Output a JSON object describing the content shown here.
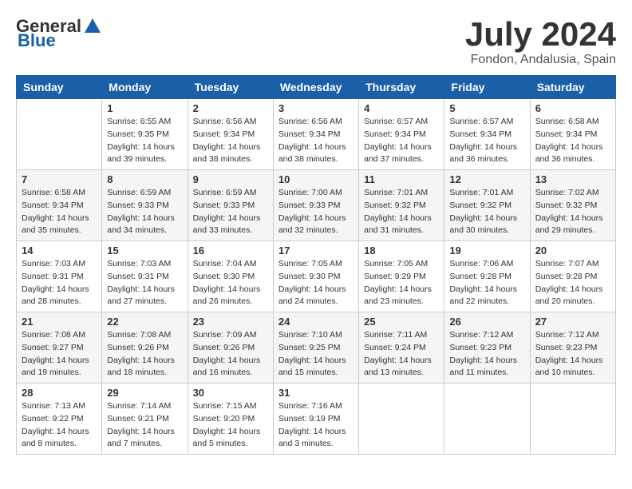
{
  "header": {
    "logo_general": "General",
    "logo_blue": "Blue",
    "month_year": "July 2024",
    "location": "Fondon, Andalusia, Spain"
  },
  "days_of_week": [
    "Sunday",
    "Monday",
    "Tuesday",
    "Wednesday",
    "Thursday",
    "Friday",
    "Saturday"
  ],
  "weeks": [
    [
      {
        "day": "",
        "sunrise": "",
        "sunset": "",
        "daylight": ""
      },
      {
        "day": "1",
        "sunrise": "Sunrise: 6:55 AM",
        "sunset": "Sunset: 9:35 PM",
        "daylight": "Daylight: 14 hours and 39 minutes."
      },
      {
        "day": "2",
        "sunrise": "Sunrise: 6:56 AM",
        "sunset": "Sunset: 9:34 PM",
        "daylight": "Daylight: 14 hours and 38 minutes."
      },
      {
        "day": "3",
        "sunrise": "Sunrise: 6:56 AM",
        "sunset": "Sunset: 9:34 PM",
        "daylight": "Daylight: 14 hours and 38 minutes."
      },
      {
        "day": "4",
        "sunrise": "Sunrise: 6:57 AM",
        "sunset": "Sunset: 9:34 PM",
        "daylight": "Daylight: 14 hours and 37 minutes."
      },
      {
        "day": "5",
        "sunrise": "Sunrise: 6:57 AM",
        "sunset": "Sunset: 9:34 PM",
        "daylight": "Daylight: 14 hours and 36 minutes."
      },
      {
        "day": "6",
        "sunrise": "Sunrise: 6:58 AM",
        "sunset": "Sunset: 9:34 PM",
        "daylight": "Daylight: 14 hours and 36 minutes."
      }
    ],
    [
      {
        "day": "7",
        "sunrise": "Sunrise: 6:58 AM",
        "sunset": "Sunset: 9:34 PM",
        "daylight": "Daylight: 14 hours and 35 minutes."
      },
      {
        "day": "8",
        "sunrise": "Sunrise: 6:59 AM",
        "sunset": "Sunset: 9:33 PM",
        "daylight": "Daylight: 14 hours and 34 minutes."
      },
      {
        "day": "9",
        "sunrise": "Sunrise: 6:59 AM",
        "sunset": "Sunset: 9:33 PM",
        "daylight": "Daylight: 14 hours and 33 minutes."
      },
      {
        "day": "10",
        "sunrise": "Sunrise: 7:00 AM",
        "sunset": "Sunset: 9:33 PM",
        "daylight": "Daylight: 14 hours and 32 minutes."
      },
      {
        "day": "11",
        "sunrise": "Sunrise: 7:01 AM",
        "sunset": "Sunset: 9:32 PM",
        "daylight": "Daylight: 14 hours and 31 minutes."
      },
      {
        "day": "12",
        "sunrise": "Sunrise: 7:01 AM",
        "sunset": "Sunset: 9:32 PM",
        "daylight": "Daylight: 14 hours and 30 minutes."
      },
      {
        "day": "13",
        "sunrise": "Sunrise: 7:02 AM",
        "sunset": "Sunset: 9:32 PM",
        "daylight": "Daylight: 14 hours and 29 minutes."
      }
    ],
    [
      {
        "day": "14",
        "sunrise": "Sunrise: 7:03 AM",
        "sunset": "Sunset: 9:31 PM",
        "daylight": "Daylight: 14 hours and 28 minutes."
      },
      {
        "day": "15",
        "sunrise": "Sunrise: 7:03 AM",
        "sunset": "Sunset: 9:31 PM",
        "daylight": "Daylight: 14 hours and 27 minutes."
      },
      {
        "day": "16",
        "sunrise": "Sunrise: 7:04 AM",
        "sunset": "Sunset: 9:30 PM",
        "daylight": "Daylight: 14 hours and 26 minutes."
      },
      {
        "day": "17",
        "sunrise": "Sunrise: 7:05 AM",
        "sunset": "Sunset: 9:30 PM",
        "daylight": "Daylight: 14 hours and 24 minutes."
      },
      {
        "day": "18",
        "sunrise": "Sunrise: 7:05 AM",
        "sunset": "Sunset: 9:29 PM",
        "daylight": "Daylight: 14 hours and 23 minutes."
      },
      {
        "day": "19",
        "sunrise": "Sunrise: 7:06 AM",
        "sunset": "Sunset: 9:28 PM",
        "daylight": "Daylight: 14 hours and 22 minutes."
      },
      {
        "day": "20",
        "sunrise": "Sunrise: 7:07 AM",
        "sunset": "Sunset: 9:28 PM",
        "daylight": "Daylight: 14 hours and 20 minutes."
      }
    ],
    [
      {
        "day": "21",
        "sunrise": "Sunrise: 7:08 AM",
        "sunset": "Sunset: 9:27 PM",
        "daylight": "Daylight: 14 hours and 19 minutes."
      },
      {
        "day": "22",
        "sunrise": "Sunrise: 7:08 AM",
        "sunset": "Sunset: 9:26 PM",
        "daylight": "Daylight: 14 hours and 18 minutes."
      },
      {
        "day": "23",
        "sunrise": "Sunrise: 7:09 AM",
        "sunset": "Sunset: 9:26 PM",
        "daylight": "Daylight: 14 hours and 16 minutes."
      },
      {
        "day": "24",
        "sunrise": "Sunrise: 7:10 AM",
        "sunset": "Sunset: 9:25 PM",
        "daylight": "Daylight: 14 hours and 15 minutes."
      },
      {
        "day": "25",
        "sunrise": "Sunrise: 7:11 AM",
        "sunset": "Sunset: 9:24 PM",
        "daylight": "Daylight: 14 hours and 13 minutes."
      },
      {
        "day": "26",
        "sunrise": "Sunrise: 7:12 AM",
        "sunset": "Sunset: 9:23 PM",
        "daylight": "Daylight: 14 hours and 11 minutes."
      },
      {
        "day": "27",
        "sunrise": "Sunrise: 7:12 AM",
        "sunset": "Sunset: 9:23 PM",
        "daylight": "Daylight: 14 hours and 10 minutes."
      }
    ],
    [
      {
        "day": "28",
        "sunrise": "Sunrise: 7:13 AM",
        "sunset": "Sunset: 9:22 PM",
        "daylight": "Daylight: 14 hours and 8 minutes."
      },
      {
        "day": "29",
        "sunrise": "Sunrise: 7:14 AM",
        "sunset": "Sunset: 9:21 PM",
        "daylight": "Daylight: 14 hours and 7 minutes."
      },
      {
        "day": "30",
        "sunrise": "Sunrise: 7:15 AM",
        "sunset": "Sunset: 9:20 PM",
        "daylight": "Daylight: 14 hours and 5 minutes."
      },
      {
        "day": "31",
        "sunrise": "Sunrise: 7:16 AM",
        "sunset": "Sunset: 9:19 PM",
        "daylight": "Daylight: 14 hours and 3 minutes."
      },
      {
        "day": "",
        "sunrise": "",
        "sunset": "",
        "daylight": ""
      },
      {
        "day": "",
        "sunrise": "",
        "sunset": "",
        "daylight": ""
      },
      {
        "day": "",
        "sunrise": "",
        "sunset": "",
        "daylight": ""
      }
    ]
  ]
}
